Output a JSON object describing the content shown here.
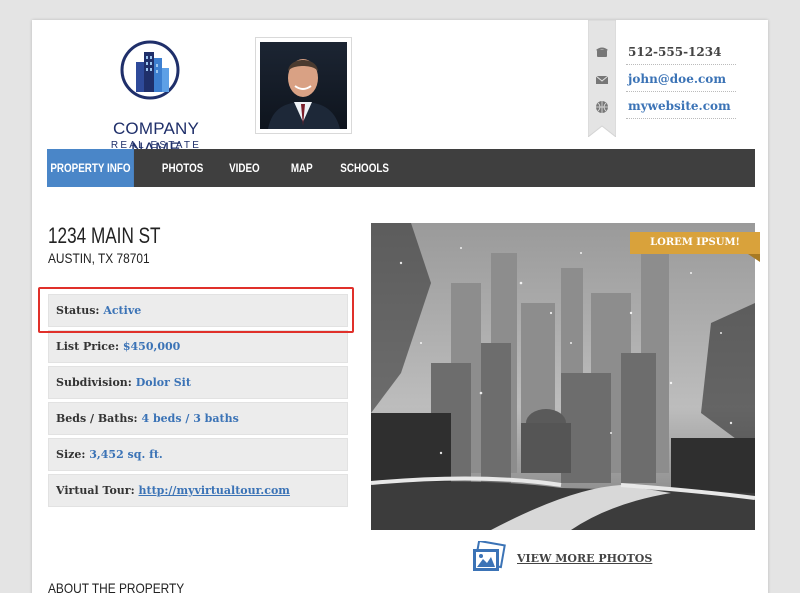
{
  "logo": {
    "name": "COMPANY NAME",
    "sub": "REAL ESTATE"
  },
  "contact": {
    "phone": "512-555-1234",
    "email": "john@doe.com",
    "website": "mywebsite.com"
  },
  "nav": {
    "items": [
      {
        "label": "PROPERTY INFO"
      },
      {
        "label": "PHOTOS"
      },
      {
        "label": "VIDEO"
      },
      {
        "label": "MAP"
      },
      {
        "label": "SCHOOLS"
      }
    ]
  },
  "address": {
    "street": "1234 MAIN ST",
    "city": "AUSTIN, TX 78701"
  },
  "details": [
    {
      "key": "Status:",
      "value": "Active"
    },
    {
      "key": "List Price:",
      "value": "$450,000"
    },
    {
      "key": "Subdivision:",
      "value": "Dolor Sit"
    },
    {
      "key": "Beds / Baths:",
      "value": "4 beds / 3 baths"
    },
    {
      "key": "Size:",
      "value": "3,452 sq. ft."
    },
    {
      "key": "Virtual Tour:",
      "value": "http://myvirtualtour.com"
    }
  ],
  "banner": "LOREM IPSUM!",
  "view_more": "VIEW MORE PHOTOS",
  "about_heading": "ABOUT THE PROPERTY",
  "colors": {
    "accent": "#4a86c8",
    "link": "#3b73b6",
    "banner": "#d9a23b",
    "highlight": "#e0302a",
    "brand": "#1f2f6a"
  }
}
